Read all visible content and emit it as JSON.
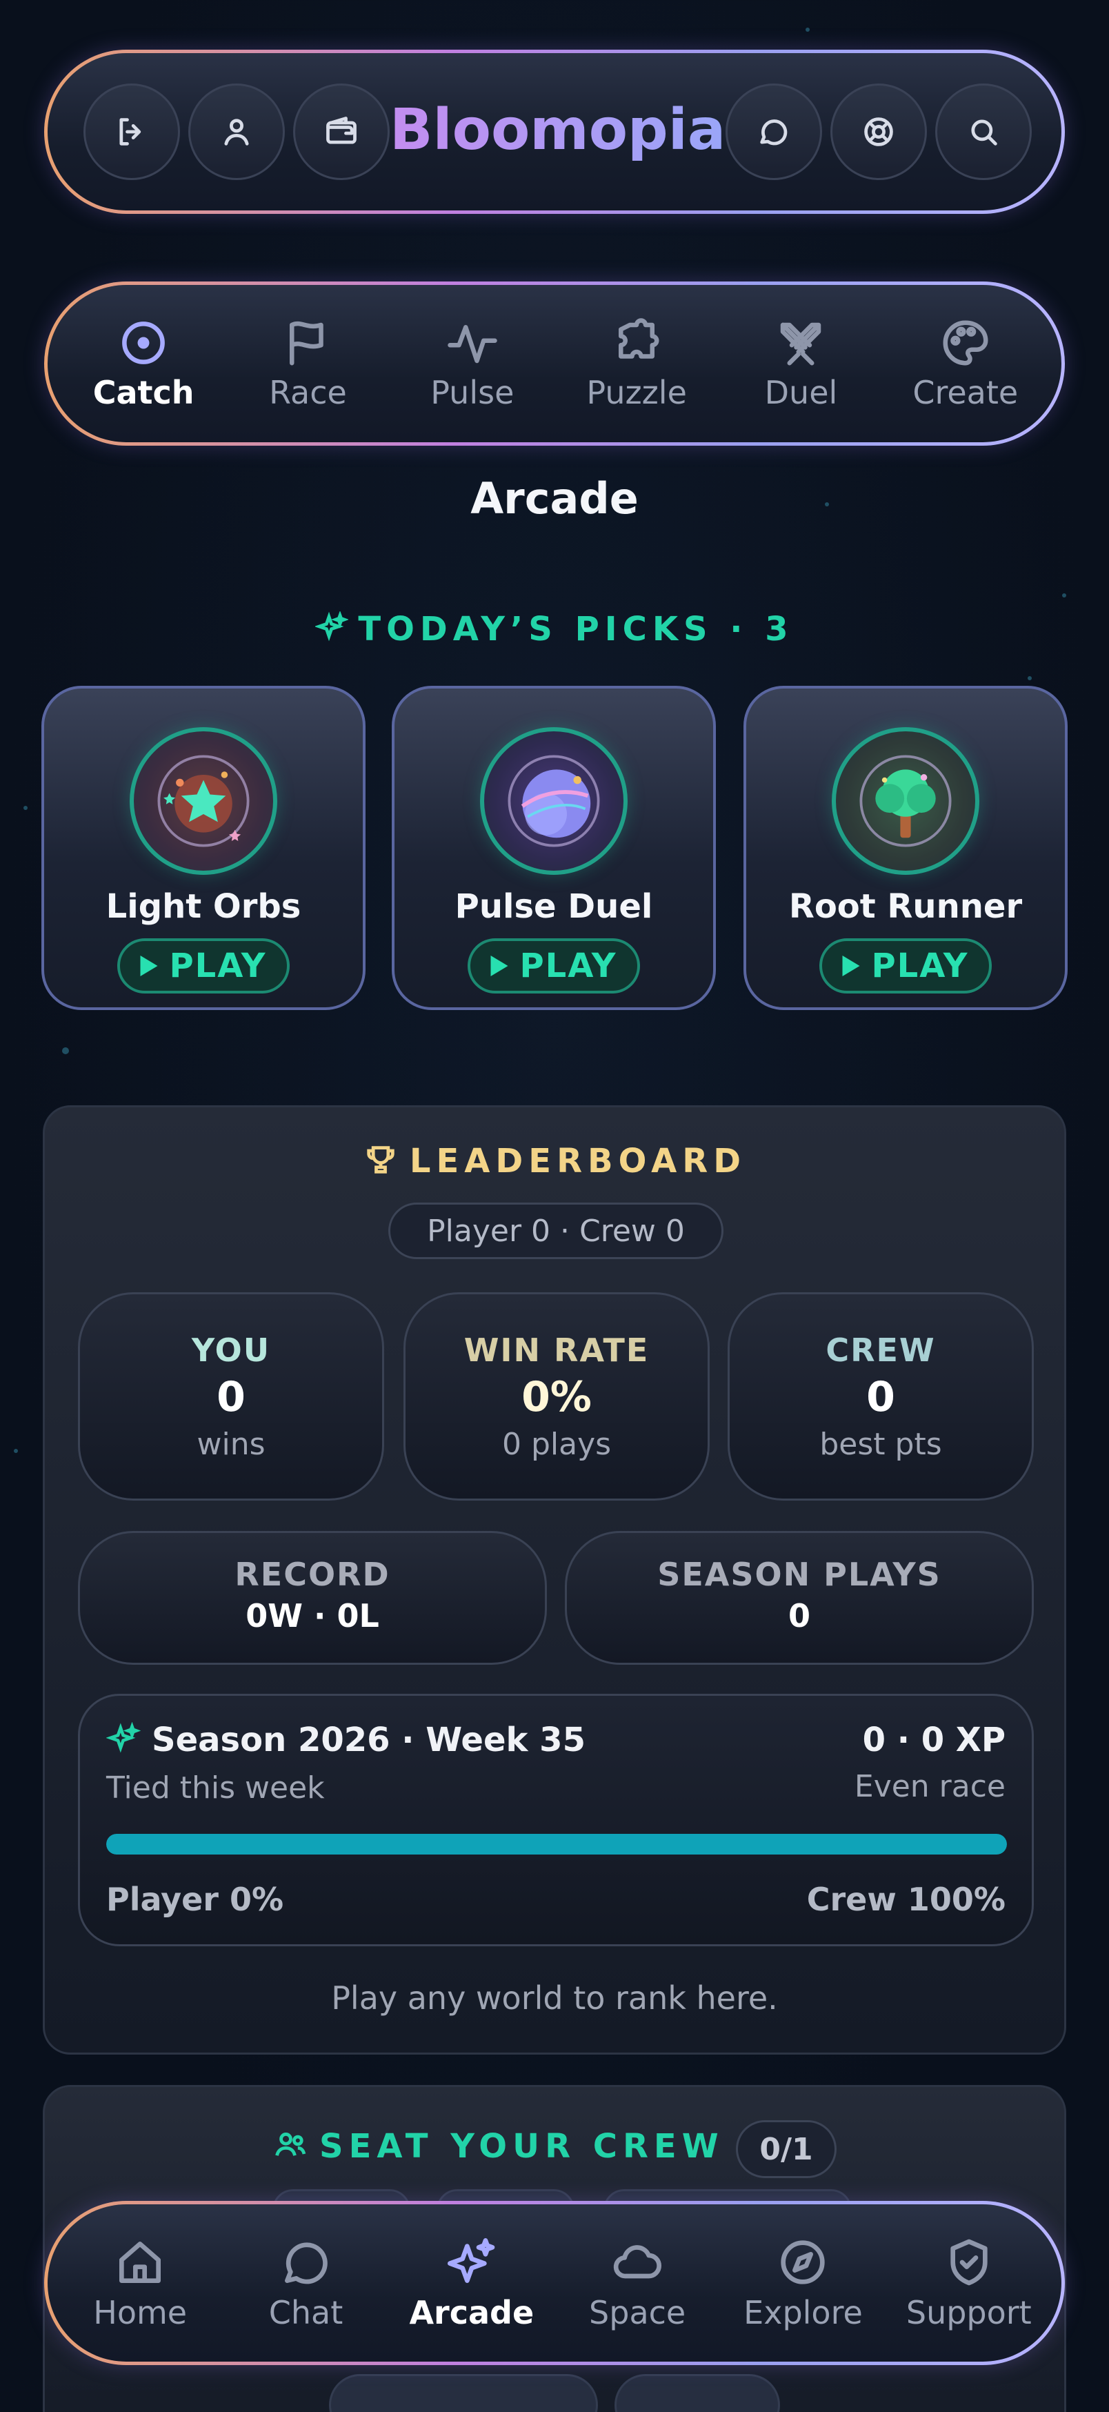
{
  "header": {
    "brand": "Bloomopia",
    "left_buttons": [
      {
        "icon": "logout-icon"
      },
      {
        "icon": "user-icon"
      },
      {
        "icon": "wallet-icon"
      }
    ],
    "right_buttons": [
      {
        "icon": "chat-bubble-icon"
      },
      {
        "icon": "lifebuoy-icon"
      },
      {
        "icon": "search-icon"
      }
    ]
  },
  "categories": [
    {
      "label": "Catch",
      "icon": "target-icon",
      "active": true
    },
    {
      "label": "Race",
      "icon": "flag-icon",
      "active": false
    },
    {
      "label": "Pulse",
      "icon": "pulse-icon",
      "active": false
    },
    {
      "label": "Puzzle",
      "icon": "puzzle-icon",
      "active": false
    },
    {
      "label": "Duel",
      "icon": "swords-icon",
      "active": false
    },
    {
      "label": "Create",
      "icon": "palette-icon",
      "active": false
    }
  ],
  "page_title": "Arcade",
  "picks": {
    "heading": "TODAY’S PICKS · 3",
    "items": [
      {
        "name": "Light Orbs",
        "play": "PLAY"
      },
      {
        "name": "Pulse Duel",
        "play": "PLAY"
      },
      {
        "name": "Root Runner",
        "play": "PLAY"
      }
    ]
  },
  "leaderboard": {
    "title": "LEADERBOARD",
    "chip": "Player 0 · Crew 0",
    "stats": [
      {
        "label": "YOU",
        "value": "0",
        "sub": "wins",
        "color": "#b6e6dc"
      },
      {
        "label": "WIN RATE",
        "value": "0%",
        "sub": "0 plays",
        "color": "#d8cfa6"
      },
      {
        "label": "CREW",
        "value": "0",
        "sub": "best pts",
        "color": "#a8d0d4"
      }
    ],
    "record": {
      "label": "RECORD",
      "value": "0W · 0L"
    },
    "season_plays": {
      "label": "SEASON PLAYS",
      "value": "0"
    },
    "season": {
      "title": "Season 2026 · Week 35",
      "xp": "0 · 0 XP",
      "status": "Tied this week",
      "race": "Even race",
      "player_label": "Player 0%",
      "crew_label": "Crew 100%",
      "crew_share": 1.0
    },
    "footer": "Play any world to rank here."
  },
  "crew": {
    "title": "SEAT YOUR CREW",
    "badge": "0/1"
  },
  "bottom_nav": [
    {
      "label": "Home",
      "icon": "home-icon",
      "active": false
    },
    {
      "label": "Chat",
      "icon": "chat-icon",
      "active": false
    },
    {
      "label": "Arcade",
      "icon": "sparkles-icon",
      "active": true
    },
    {
      "label": "Space",
      "icon": "cloud-icon",
      "active": false
    },
    {
      "label": "Explore",
      "icon": "compass-icon",
      "active": false
    },
    {
      "label": "Support",
      "icon": "shield-check-icon",
      "active": false
    }
  ],
  "colors": {
    "accent_teal": "#22d3a8",
    "accent_gold": "#f3d488",
    "accent_violet": "#a6aaff",
    "progress": "#0fa3b8"
  }
}
